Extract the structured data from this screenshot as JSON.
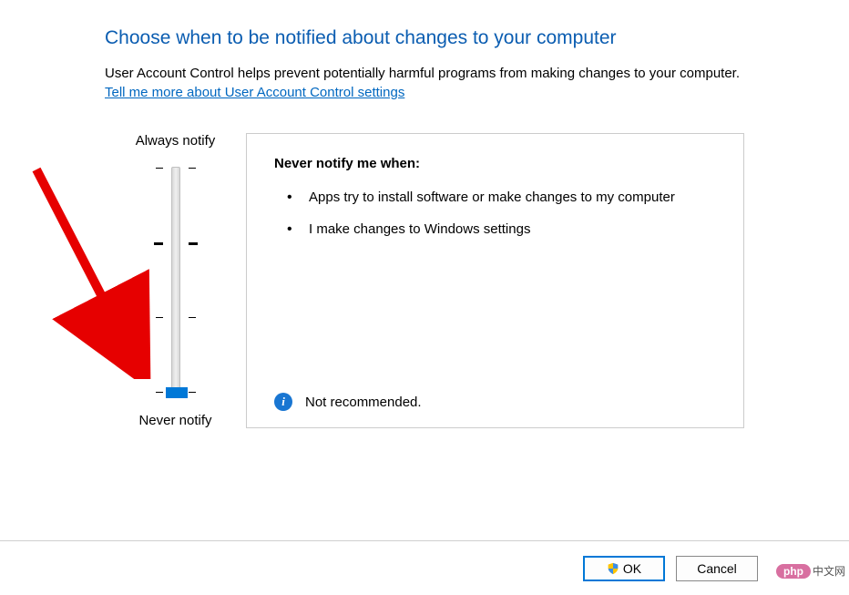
{
  "title": "Choose when to be notified about changes to your computer",
  "description": "User Account Control helps prevent potentially harmful programs from making changes to your computer.",
  "learn_more": "Tell me more about User Account Control settings",
  "slider": {
    "top_label": "Always notify",
    "bottom_label": "Never notify"
  },
  "panel": {
    "heading": "Never notify me when:",
    "items": [
      "Apps try to install software or make changes to my computer",
      "I make changes to Windows settings"
    ],
    "recommendation": "Not recommended."
  },
  "buttons": {
    "ok": "OK",
    "cancel": "Cancel"
  },
  "watermark": {
    "badge": "php",
    "text": "中文网"
  }
}
